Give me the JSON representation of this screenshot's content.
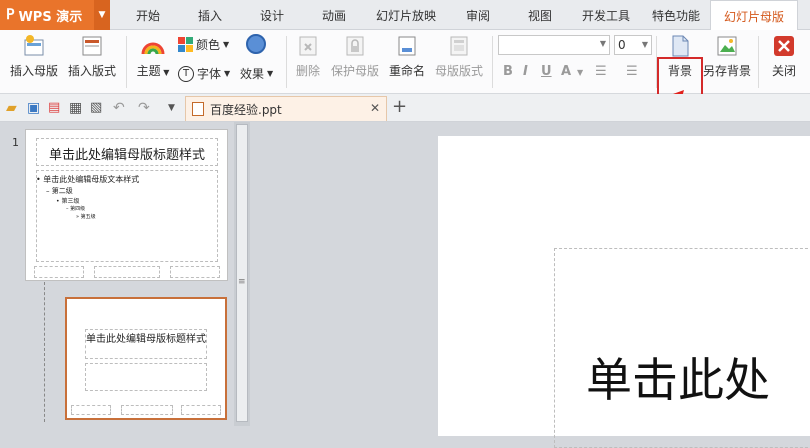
{
  "app": {
    "name": "WPS 演示"
  },
  "tabs": [
    {
      "label": "开始"
    },
    {
      "label": "插入"
    },
    {
      "label": "设计"
    },
    {
      "label": "动画"
    },
    {
      "label": "幻灯片放映"
    },
    {
      "label": "审阅"
    },
    {
      "label": "视图"
    },
    {
      "label": "开发工具"
    },
    {
      "label": "特色功能"
    },
    {
      "label": "幻灯片母版"
    }
  ],
  "active_tab": "幻灯片母版",
  "ribbon": {
    "insert_master": "插入母版",
    "insert_layout": "插入版式",
    "theme": "主题",
    "color": "颜色",
    "font": "字体",
    "effect": "效果",
    "delete": "删除",
    "protect_master": "保护母版",
    "rename": "重命名",
    "master_layout": "母版版式",
    "font_size": "0",
    "background": "背景",
    "save_background": "另存背景",
    "close": "关闭"
  },
  "document": {
    "tab_title": "百度经验.ppt"
  },
  "slides": {
    "num1": "1",
    "master_title": "单击此处编辑母版标题样式",
    "master_text": "单击此处编辑母版文本样式",
    "level2": "第二级",
    "level3": "第三级",
    "level4": "第四级",
    "level5": "第五级",
    "layout_title": "单击此处编辑母版标题样式"
  },
  "main": {
    "title_text": "单击此处"
  },
  "colors": {
    "accent": "#e9742b",
    "highlight": "#d42a2a"
  }
}
